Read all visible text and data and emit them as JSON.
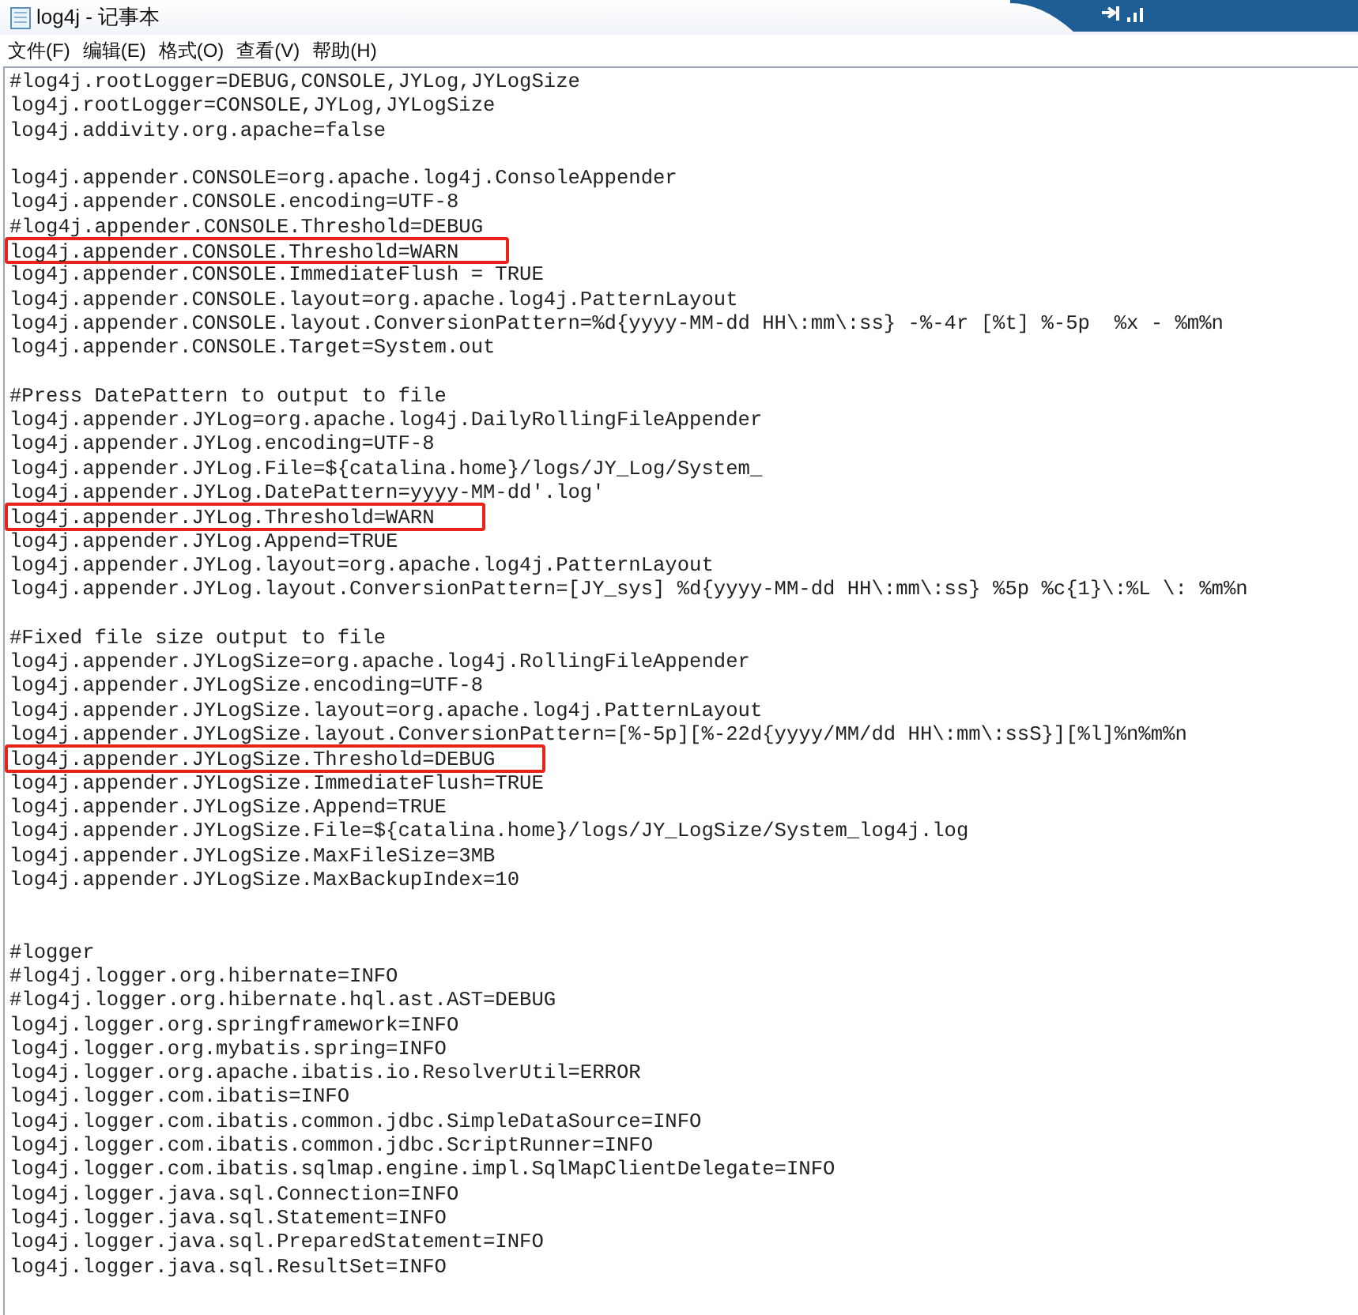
{
  "window": {
    "title": "log4j - 记事本"
  },
  "menu": [
    "文件(F)",
    "编辑(E)",
    "格式(O)",
    "查看(V)",
    "帮助(H)"
  ],
  "lines": [
    {
      "kind": "code",
      "text": "#log4j.rootLogger=DEBUG,CONSOLE,JYLog,JYLogSize",
      "highlighted": false
    },
    {
      "kind": "code",
      "text": "log4j.rootLogger=CONSOLE,JYLog,JYLogSize",
      "highlighted": false
    },
    {
      "kind": "code",
      "text": "log4j.addivity.org.apache=false",
      "highlighted": false
    },
    {
      "kind": "blank"
    },
    {
      "kind": "code",
      "text": "log4j.appender.CONSOLE=org.apache.log4j.ConsoleAppender",
      "highlighted": false
    },
    {
      "kind": "code",
      "text": "log4j.appender.CONSOLE.encoding=UTF-8",
      "highlighted": false
    },
    {
      "kind": "code",
      "text": "#log4j.appender.CONSOLE.Threshold=DEBUG",
      "highlighted": false
    },
    {
      "kind": "code",
      "text": "log4j.appender.CONSOLE.Threshold=WARN",
      "highlighted": true
    },
    {
      "kind": "code",
      "text": "log4j.appender.CONSOLE.ImmediateFlush = TRUE",
      "highlighted": false
    },
    {
      "kind": "code",
      "text": "log4j.appender.CONSOLE.layout=org.apache.log4j.PatternLayout",
      "highlighted": false
    },
    {
      "kind": "code",
      "text": "log4j.appender.CONSOLE.layout.ConversionPattern=%d{yyyy-MM-dd HH\\:mm\\:ss} -%-4r [%t] %-5p  %x - %m%n",
      "highlighted": false
    },
    {
      "kind": "code",
      "text": "log4j.appender.CONSOLE.Target=System.out",
      "highlighted": false
    },
    {
      "kind": "blank"
    },
    {
      "kind": "code",
      "text": "#Press DatePattern to output to file",
      "highlighted": false
    },
    {
      "kind": "code",
      "text": "log4j.appender.JYLog=org.apache.log4j.DailyRollingFileAppender",
      "highlighted": false
    },
    {
      "kind": "code",
      "text": "log4j.appender.JYLog.encoding=UTF-8",
      "highlighted": false
    },
    {
      "kind": "code",
      "text": "log4j.appender.JYLog.File=${catalina.home}/logs/JY_Log/System_",
      "highlighted": false
    },
    {
      "kind": "code",
      "text": "log4j.appender.JYLog.DatePattern=yyyy-MM-dd'.log'",
      "highlighted": false
    },
    {
      "kind": "code",
      "text": "log4j.appender.JYLog.Threshold=WARN",
      "highlighted": true
    },
    {
      "kind": "code",
      "text": "log4j.appender.JYLog.Append=TRUE",
      "highlighted": false
    },
    {
      "kind": "code",
      "text": "log4j.appender.JYLog.layout=org.apache.log4j.PatternLayout",
      "highlighted": false
    },
    {
      "kind": "code",
      "text": "log4j.appender.JYLog.layout.ConversionPattern=[JY_sys] %d{yyyy-MM-dd HH\\:mm\\:ss} %5p %c{1}\\:%L \\: %m%n",
      "highlighted": false
    },
    {
      "kind": "blank"
    },
    {
      "kind": "code",
      "text": "#Fixed file size output to file",
      "highlighted": false
    },
    {
      "kind": "code",
      "text": "log4j.appender.JYLogSize=org.apache.log4j.RollingFileAppender",
      "highlighted": false
    },
    {
      "kind": "code",
      "text": "log4j.appender.JYLogSize.encoding=UTF-8",
      "highlighted": false
    },
    {
      "kind": "code",
      "text": "log4j.appender.JYLogSize.layout=org.apache.log4j.PatternLayout",
      "highlighted": false
    },
    {
      "kind": "code",
      "text": "log4j.appender.JYLogSize.layout.ConversionPattern=[%-5p][%-22d{yyyy/MM/dd HH\\:mm\\:ssS}][%l]%n%m%n",
      "highlighted": false
    },
    {
      "kind": "code",
      "text": "log4j.appender.JYLogSize.Threshold=DEBUG",
      "highlighted": true
    },
    {
      "kind": "code",
      "text": "log4j.appender.JYLogSize.ImmediateFlush=TRUE",
      "highlighted": false
    },
    {
      "kind": "code",
      "text": "log4j.appender.JYLogSize.Append=TRUE",
      "highlighted": false
    },
    {
      "kind": "code",
      "text": "log4j.appender.JYLogSize.File=${catalina.home}/logs/JY_LogSize/System_log4j.log",
      "highlighted": false
    },
    {
      "kind": "code",
      "text": "log4j.appender.JYLogSize.MaxFileSize=3MB",
      "highlighted": false
    },
    {
      "kind": "code",
      "text": "log4j.appender.JYLogSize.MaxBackupIndex=10",
      "highlighted": false
    },
    {
      "kind": "blank"
    },
    {
      "kind": "blank"
    },
    {
      "kind": "code",
      "text": "#logger",
      "highlighted": false
    },
    {
      "kind": "code",
      "text": "#log4j.logger.org.hibernate=INFO",
      "highlighted": false
    },
    {
      "kind": "code",
      "text": "#log4j.logger.org.hibernate.hql.ast.AST=DEBUG",
      "highlighted": false
    },
    {
      "kind": "code",
      "text": "log4j.logger.org.springframework=INFO",
      "highlighted": false
    },
    {
      "kind": "code",
      "text": "log4j.logger.org.mybatis.spring=INFO",
      "highlighted": false
    },
    {
      "kind": "code",
      "text": "log4j.logger.org.apache.ibatis.io.ResolverUtil=ERROR",
      "highlighted": false
    },
    {
      "kind": "code",
      "text": "log4j.logger.com.ibatis=INFO",
      "highlighted": false
    },
    {
      "kind": "code",
      "text": "log4j.logger.com.ibatis.common.jdbc.SimpleDataSource=INFO",
      "highlighted": false
    },
    {
      "kind": "code",
      "text": "log4j.logger.com.ibatis.common.jdbc.ScriptRunner=INFO",
      "highlighted": false
    },
    {
      "kind": "code",
      "text": "log4j.logger.com.ibatis.sqlmap.engine.impl.SqlMapClientDelegate=INFO",
      "highlighted": false
    },
    {
      "kind": "code",
      "text": "log4j.logger.java.sql.Connection=INFO",
      "highlighted": false
    },
    {
      "kind": "code",
      "text": "log4j.logger.java.sql.Statement=INFO",
      "highlighted": false
    },
    {
      "kind": "code",
      "text": "log4j.logger.java.sql.PreparedStatement=INFO",
      "highlighted": false
    },
    {
      "kind": "code",
      "text": "log4j.logger.java.sql.ResultSet=INFO",
      "highlighted": false
    }
  ]
}
